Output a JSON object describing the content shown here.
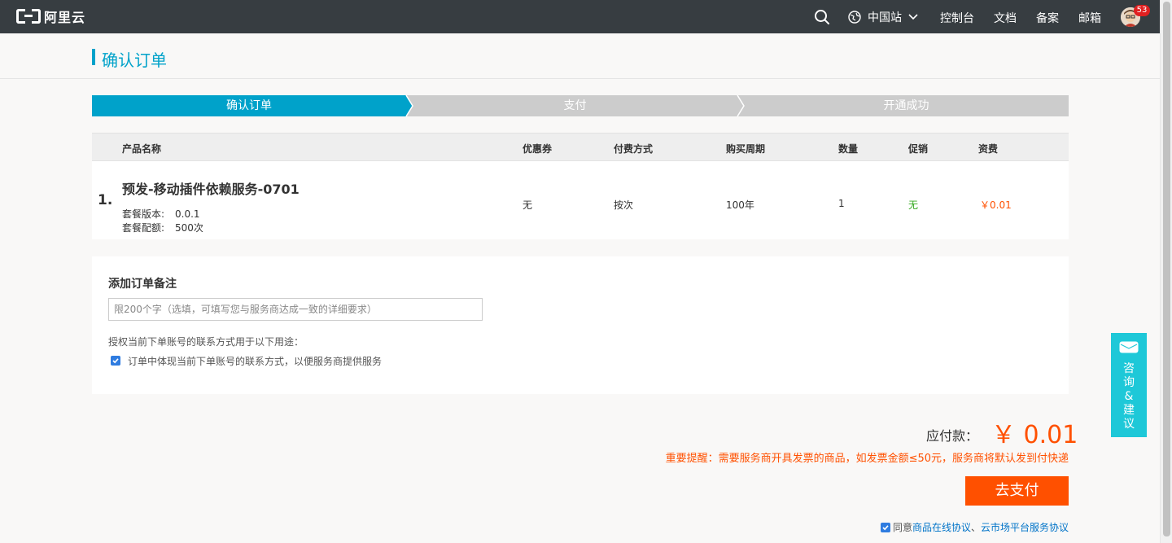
{
  "topbar": {
    "logo_text": "阿里云",
    "region": "中国站",
    "nav": [
      "控制台",
      "文档",
      "备案",
      "邮箱"
    ],
    "badge_count": "53"
  },
  "page": {
    "title": "确认订单"
  },
  "steps": [
    "确认订单",
    "支付",
    "开通成功"
  ],
  "colors": {
    "accent": "#00a2ca",
    "step_active": "#00a2ca",
    "step_inactive": "#cccccc",
    "price": "#ff5000",
    "promo": "#33a81f"
  },
  "table": {
    "headers": [
      "产品名称",
      "优惠券",
      "付费方式",
      "购买周期",
      "数量",
      "促销",
      "资费"
    ],
    "row": {
      "index": "1.",
      "product_name": "预发-移动插件依赖服务-0701",
      "version_label": "套餐版本:",
      "version_value": "0.0.1",
      "quota_label": "套餐配额:",
      "quota_value": "500次",
      "coupon": "无",
      "pay_method": "按次",
      "period": "100年",
      "quantity": "1",
      "promotion": "无",
      "price": "￥0.01"
    }
  },
  "notes": {
    "title": "添加订单备注",
    "placeholder": "限200个字（选填，可填写您与服务商达成一致的详细要求）",
    "auth_text": "授权当前下单账号的联系方式用于以下用途：",
    "auth_checkbox_label": "订单中体现当前下单账号的联系方式，以便服务商提供服务"
  },
  "consult": {
    "chars": [
      "咨",
      "询",
      "&",
      "建",
      "议"
    ]
  },
  "payment": {
    "label": "应付款：",
    "amount": "￥ 0.01",
    "reminder": "重要提醒：需要服务商开具发票的商品，如发票金额≤50元，服务商将默认发到付快递",
    "button": "去支付",
    "agree_prefix": "同意",
    "agree_link1": "商品在线协议",
    "agree_sep": "、",
    "agree_link2": "云市场平台服务协议"
  }
}
